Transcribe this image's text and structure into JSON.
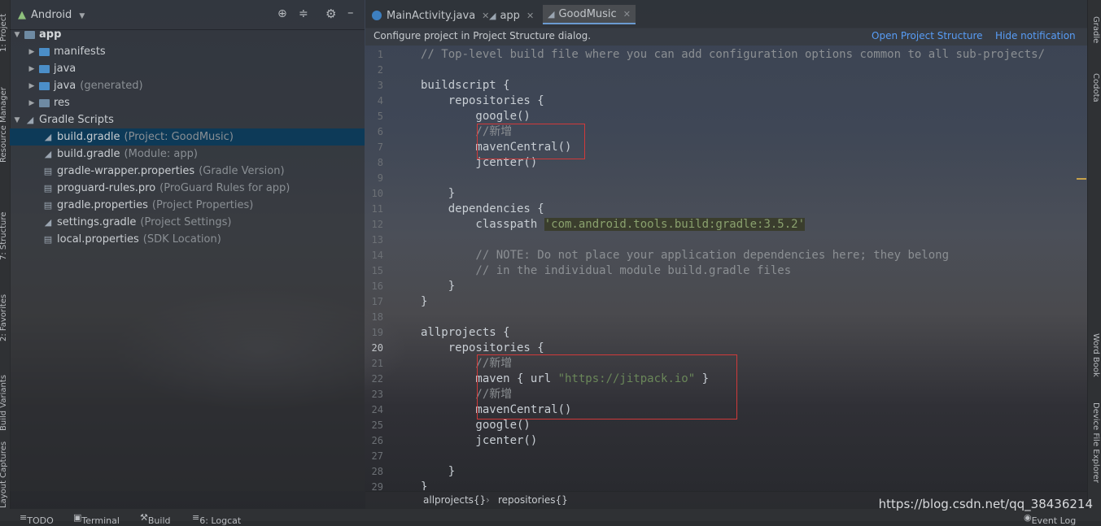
{
  "left_toolbar": {
    "tabs": [
      "1: Project",
      "Resource Manager",
      "7: Structure",
      "2: Favorites",
      "Build Variants",
      "Layout Captures"
    ]
  },
  "right_toolbar": {
    "tabs": [
      "Gradle",
      "Codota",
      "Word Book",
      "Device File Explorer"
    ]
  },
  "project_panel": {
    "view_mode": "Android",
    "tree": [
      {
        "name": "app",
        "hint": ""
      },
      {
        "name": "manifests",
        "hint": ""
      },
      {
        "name": "java",
        "hint": ""
      },
      {
        "name": "java",
        "hint": "(generated)"
      },
      {
        "name": "res",
        "hint": ""
      },
      {
        "name": "Gradle Scripts",
        "hint": ""
      },
      {
        "name": "build.gradle",
        "hint": "(Project: GoodMusic)"
      },
      {
        "name": "build.gradle",
        "hint": "(Module: app)"
      },
      {
        "name": "gradle-wrapper.properties",
        "hint": "(Gradle Version)"
      },
      {
        "name": "proguard-rules.pro",
        "hint": "(ProGuard Rules for app)"
      },
      {
        "name": "gradle.properties",
        "hint": "(Project Properties)"
      },
      {
        "name": "settings.gradle",
        "hint": "(Project Settings)"
      },
      {
        "name": "local.properties",
        "hint": "(SDK Location)"
      }
    ]
  },
  "editor": {
    "tabs": [
      {
        "label": "MainActivity.java"
      },
      {
        "label": "app"
      },
      {
        "label": "GoodMusic"
      }
    ],
    "notification": {
      "message": "Configure project in Project Structure dialog.",
      "action_open": "Open Project Structure",
      "action_hide": "Hide notification"
    },
    "line_numbers": [
      "1",
      "2",
      "3",
      "4",
      "5",
      "6",
      "7",
      "8",
      "9",
      "10",
      "11",
      "12",
      "13",
      "14",
      "15",
      "16",
      "17",
      "18",
      "19",
      "20",
      "21",
      "22",
      "23",
      "24",
      "25",
      "26",
      "27",
      "28",
      "29"
    ],
    "code_lines": [
      "// Top-level build file where you can add configuration options common to all sub-projects/",
      "",
      "buildscript {",
      "    repositories {",
      "        google()",
      "        //新增",
      "        mavenCentral()",
      "        jcenter()",
      "",
      "    }",
      "    dependencies {",
      "        classpath 'com.android.tools.build:gradle:3.5.2'",
      "",
      "        // NOTE: Do not place your application dependencies here; they belong",
      "        // in the individual module build.gradle files",
      "    }",
      "}",
      "",
      "allprojects {",
      "    repositories {",
      "        //新增",
      "        maven { url \"https://jitpack.io\" }",
      "        //新增",
      "        mavenCentral()",
      "        google()",
      "        jcenter()",
      "",
      "    }",
      "}"
    ],
    "breadcrumb": [
      "allprojects{}",
      "repositories{}"
    ]
  },
  "status_bar": {
    "items": [
      "TODO",
      "Terminal",
      "Build",
      "6: Logcat"
    ],
    "event_log": "Event Log"
  },
  "watermark": "https://blog.csdn.net/qq_38436214"
}
